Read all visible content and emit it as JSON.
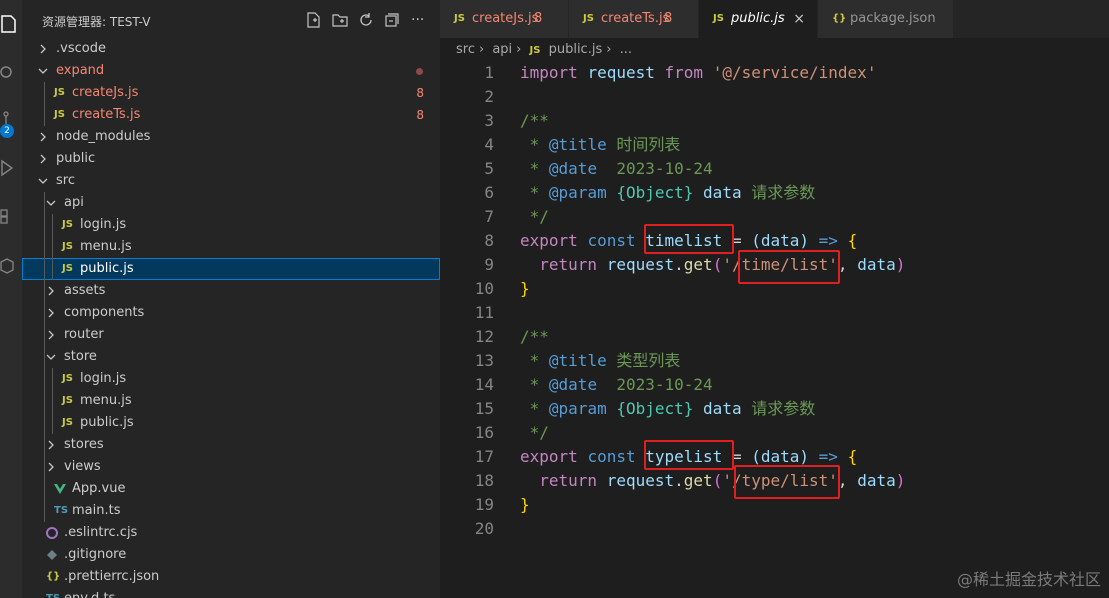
{
  "explorer": {
    "title": "资源管理器: TEST-V",
    "tree": [
      {
        "label": ".vscode",
        "kind": "folder",
        "open": false,
        "depth": 0
      },
      {
        "label": "expand",
        "kind": "folder",
        "open": true,
        "depth": 0,
        "error": true,
        "dot": true
      },
      {
        "label": "createJs.js",
        "kind": "js",
        "depth": 1,
        "error": true,
        "count": "8"
      },
      {
        "label": "createTs.js",
        "kind": "js",
        "depth": 1,
        "error": true,
        "count": "8"
      },
      {
        "label": "node_modules",
        "kind": "folder",
        "open": false,
        "depth": 0
      },
      {
        "label": "public",
        "kind": "folder",
        "open": false,
        "depth": 0
      },
      {
        "label": "src",
        "kind": "folder",
        "open": true,
        "depth": 0
      },
      {
        "label": "api",
        "kind": "folder",
        "open": true,
        "depth": 1
      },
      {
        "label": "login.js",
        "kind": "js",
        "depth": 2
      },
      {
        "label": "menu.js",
        "kind": "js",
        "depth": 2
      },
      {
        "label": "public.js",
        "kind": "js",
        "depth": 2,
        "selected": true
      },
      {
        "label": "assets",
        "kind": "folder",
        "open": false,
        "depth": 1
      },
      {
        "label": "components",
        "kind": "folder",
        "open": false,
        "depth": 1
      },
      {
        "label": "router",
        "kind": "folder",
        "open": false,
        "depth": 1
      },
      {
        "label": "store",
        "kind": "folder",
        "open": true,
        "depth": 1
      },
      {
        "label": "login.js",
        "kind": "js",
        "depth": 2
      },
      {
        "label": "menu.js",
        "kind": "js",
        "depth": 2
      },
      {
        "label": "public.js",
        "kind": "js",
        "depth": 2
      },
      {
        "label": "stores",
        "kind": "folder",
        "open": false,
        "depth": 1
      },
      {
        "label": "views",
        "kind": "folder",
        "open": false,
        "depth": 1
      },
      {
        "label": "App.vue",
        "kind": "vue",
        "depth": 1
      },
      {
        "label": "main.ts",
        "kind": "ts",
        "depth": 1
      },
      {
        "label": ".eslintrc.cjs",
        "kind": "eslint",
        "depth": 0
      },
      {
        "label": ".gitignore",
        "kind": "git",
        "depth": 0
      },
      {
        "label": ".prettierrc.json",
        "kind": "json",
        "depth": 0
      },
      {
        "label": "env.d.ts",
        "kind": "ts",
        "depth": 0
      }
    ]
  },
  "activity_badge": "2",
  "tabs": [
    {
      "label": "createJs.js",
      "count": "8",
      "error": true,
      "icon": "JS"
    },
    {
      "label": "createTs.js",
      "count": "8",
      "error": true,
      "icon": "JS"
    },
    {
      "label": "public.js",
      "active": true,
      "icon": "JS",
      "close": "×"
    },
    {
      "label": "package.json",
      "icon": "{}"
    }
  ],
  "breadcrumb": [
    "src",
    "api",
    "public.js",
    "..."
  ],
  "code_lines": [
    "1",
    "2",
    "3",
    "4",
    "5",
    "6",
    "7",
    "8",
    "9",
    "10",
    "11",
    "12",
    "13",
    "14",
    "15",
    "16",
    "17",
    "18",
    "19",
    "20"
  ],
  "code": {
    "l1": {
      "a": "import",
      "b": "request",
      "c": "from",
      "d": "'@/service/index'"
    },
    "l3": "/**",
    "l4": {
      "a": " * ",
      "b": "@title",
      "c": " 时间列表"
    },
    "l5": {
      "a": " * ",
      "b": "@date",
      "c": "  2023-10-24"
    },
    "l6": {
      "a": " * ",
      "b": "@param",
      "c": "{Object}",
      "d": "data",
      "e": " 请求参数"
    },
    "l7": " */",
    "l8": {
      "a": "export",
      "b": "const",
      "c": "timelist",
      "d": "(data)",
      "e": "=>"
    },
    "l9": {
      "a": "return",
      "b": "request",
      "c": "get",
      "d": "'/time/list'",
      "e": "data"
    },
    "l12": "/**",
    "l13": {
      "a": " * ",
      "b": "@title",
      "c": " 类型列表"
    },
    "l14": {
      "a": " * ",
      "b": "@date",
      "c": "  2023-10-24"
    },
    "l15": {
      "a": " * ",
      "b": "@param",
      "c": "{Object}",
      "d": "data",
      "e": " 请求参数"
    },
    "l16": " */",
    "l17": {
      "a": "export",
      "b": "const",
      "c": "typelist",
      "d": "(data)",
      "e": "=>"
    },
    "l18": {
      "a": "return",
      "b": "request",
      "c": "get",
      "d": "'/type/list'",
      "e": "data"
    }
  },
  "watermark": "@稀土掘金技术社区",
  "colors": {
    "accent": "#007fd4",
    "error": "#f48771",
    "highlight_box": "#e02020"
  }
}
